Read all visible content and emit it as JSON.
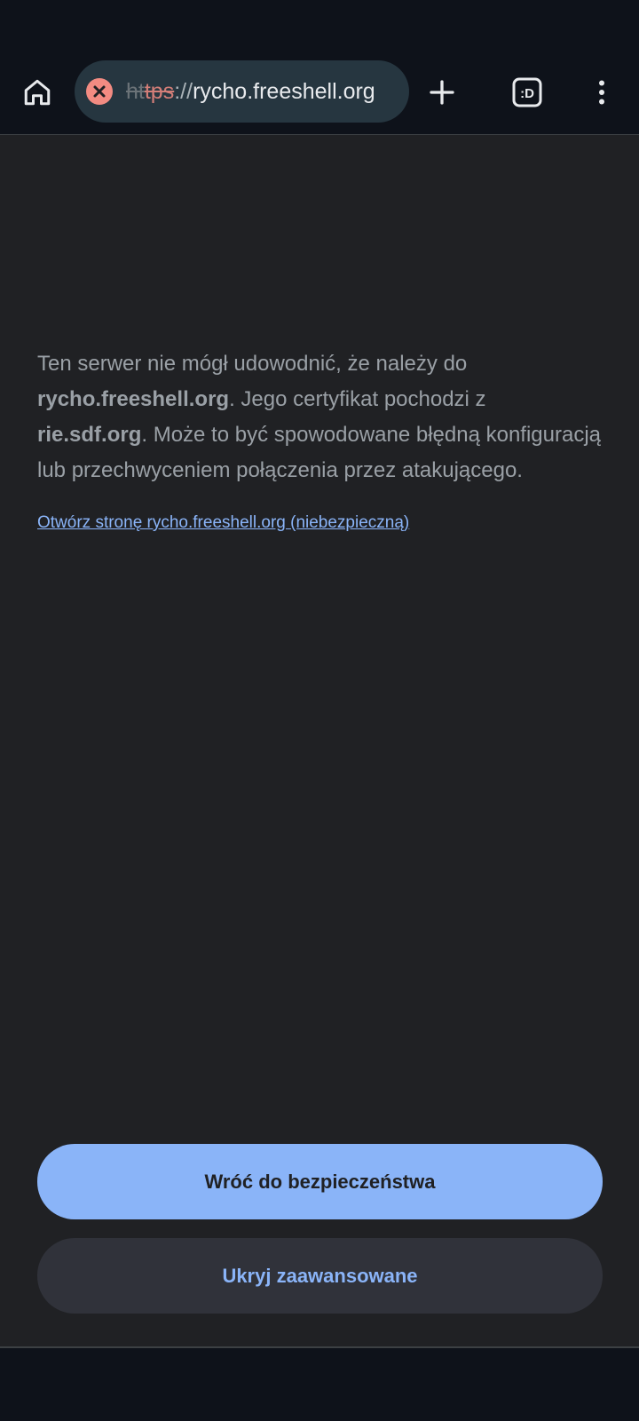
{
  "colors": {
    "toolbar_bg": "#0e121a",
    "page_bg": "#202124",
    "omnibox_bg": "#263640",
    "danger": "#f28b82",
    "link": "#8ab4f8",
    "text_muted": "#9aa0a6"
  },
  "toolbar": {
    "home_icon": "home-icon",
    "url_scheme_faded": "ht",
    "url_scheme": "tps",
    "url_sep": "://",
    "url_host": "rycho.freeshell.org",
    "security_icon": "not-secure-icon",
    "new_tab_icon": "plus-icon",
    "tabs_icon": "tab-switcher-icon",
    "tabs_count": ":D",
    "menu_icon": "more-vert-icon"
  },
  "interstitial": {
    "msg_part1": "Ten serwer nie mógł udowodnić, że należy do ",
    "msg_host": "rycho.freeshell.org",
    "msg_part2": ". Jego certyfikat pochodzi z ",
    "msg_cert": "rie.sdf.org",
    "msg_part3": ". Może to być spowodowane błędną konfiguracją lub przechwyceniem połączenia przez atakującego.",
    "proceed_link": "Otwórz stronę rycho.freeshell.org (niebezpieczną)",
    "back_button": "Wróć do bezpieczeństwa",
    "hide_advanced_button": "Ukryj zaawansowane"
  }
}
